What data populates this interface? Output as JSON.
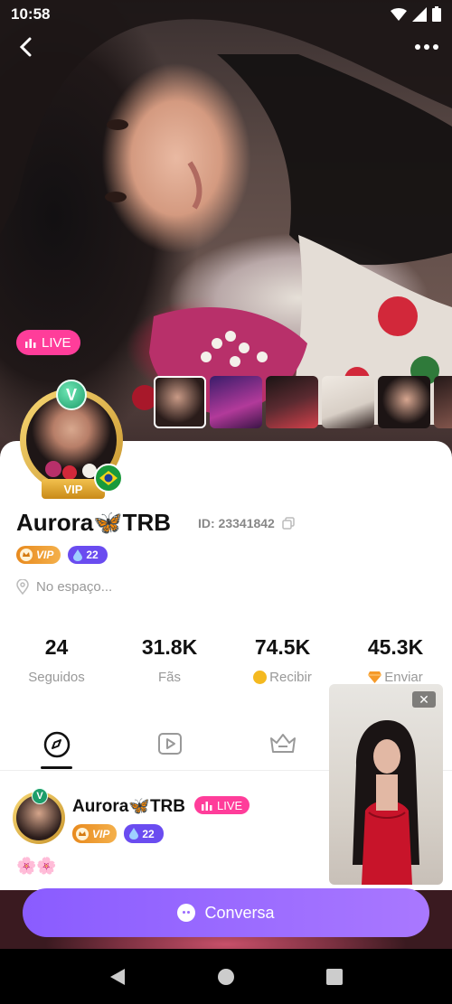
{
  "status": {
    "time": "10:58"
  },
  "hero": {
    "live_label": "LIVE",
    "thumbnail_count": 6
  },
  "profile": {
    "name": "Aurora🦋TRB",
    "id_text": "ID: 23341842",
    "vip_label": "VIP",
    "vip_pill_label": "VIP",
    "verified_letter": "V",
    "level": "22",
    "location": "No espaço..."
  },
  "stats": [
    {
      "value": "24",
      "label": "Seguidos"
    },
    {
      "value": "31.8K",
      "label": "Fãs"
    },
    {
      "value": "74.5K",
      "label": "Recibir"
    },
    {
      "value": "45.3K",
      "label": "Enviar"
    }
  ],
  "post": {
    "name": "Aurora🦋TRB",
    "live_label": "LIVE",
    "vip_label": "VIP",
    "level": "22",
    "emoji": "🌸🌸"
  },
  "float_video": {
    "close_label": "✕"
  },
  "chat_button": {
    "label": "Conversa"
  },
  "colors": {
    "accent": "#8a5cff",
    "live": "#ff3d9a",
    "level": "#6a4cf0",
    "vip": "#f4b04b"
  }
}
